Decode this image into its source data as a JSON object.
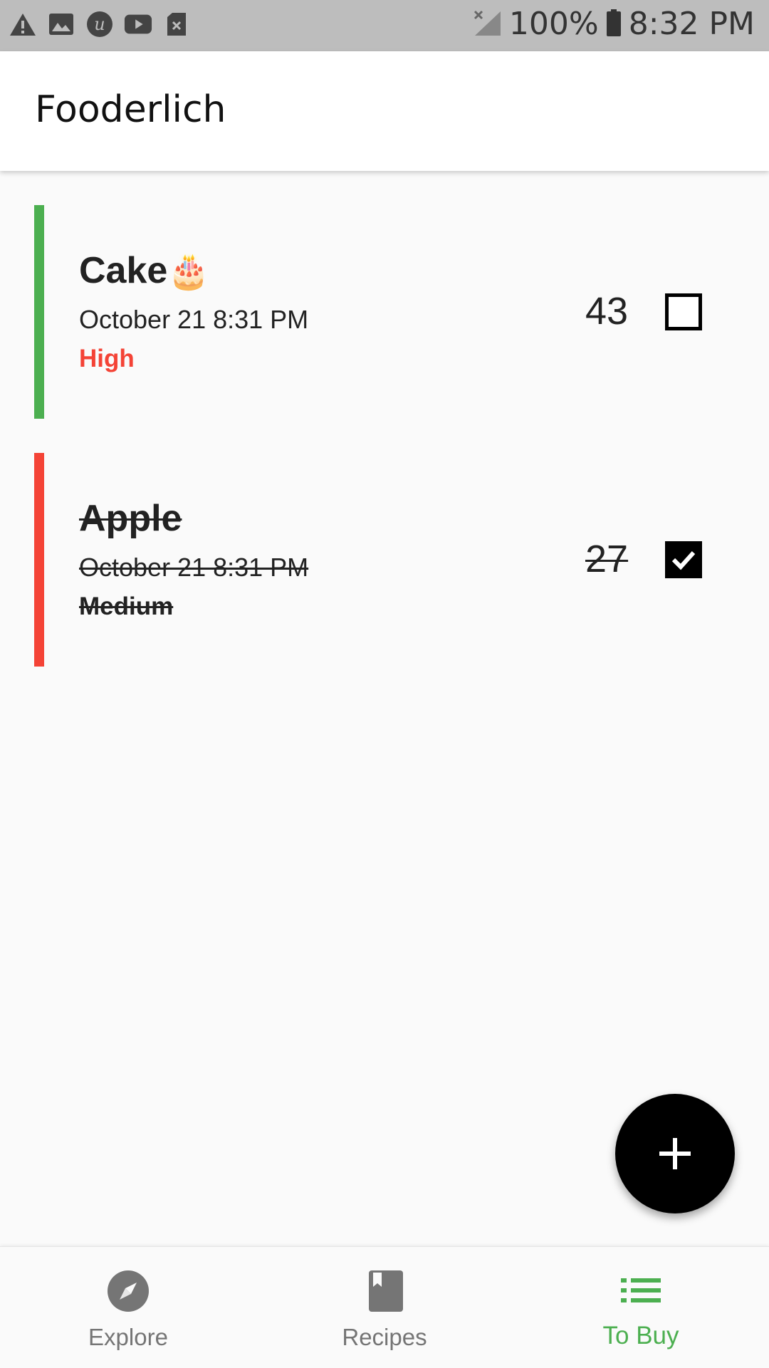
{
  "status_bar": {
    "icons_left": [
      "warning-icon",
      "image-icon",
      "upwork-icon",
      "youtube-icon",
      "sim-card-icon"
    ],
    "battery": "100%",
    "time": "8:32 PM"
  },
  "app_bar": {
    "title": "Fooderlich"
  },
  "items": [
    {
      "name": "Cake",
      "emoji": "🎂",
      "date": "October 21 8:31 PM",
      "priority": "High",
      "quantity": "43",
      "checked": false,
      "bar_color": "#4caf50",
      "priority_color": "#f44336"
    },
    {
      "name": "Apple",
      "date": "October 21 8:31 PM",
      "priority": "Medium",
      "quantity": "27",
      "checked": true,
      "bar_color": "#f44336",
      "priority_color": "#222222"
    }
  ],
  "fab": {
    "icon": "plus-icon"
  },
  "bottom_nav": {
    "items": [
      {
        "label": "Explore",
        "icon": "compass-icon",
        "active": false
      },
      {
        "label": "Recipes",
        "icon": "book-icon",
        "active": false
      },
      {
        "label": "To Buy",
        "icon": "list-icon",
        "active": true
      }
    ],
    "active_color": "#4caf50",
    "inactive_color": "#757575"
  }
}
